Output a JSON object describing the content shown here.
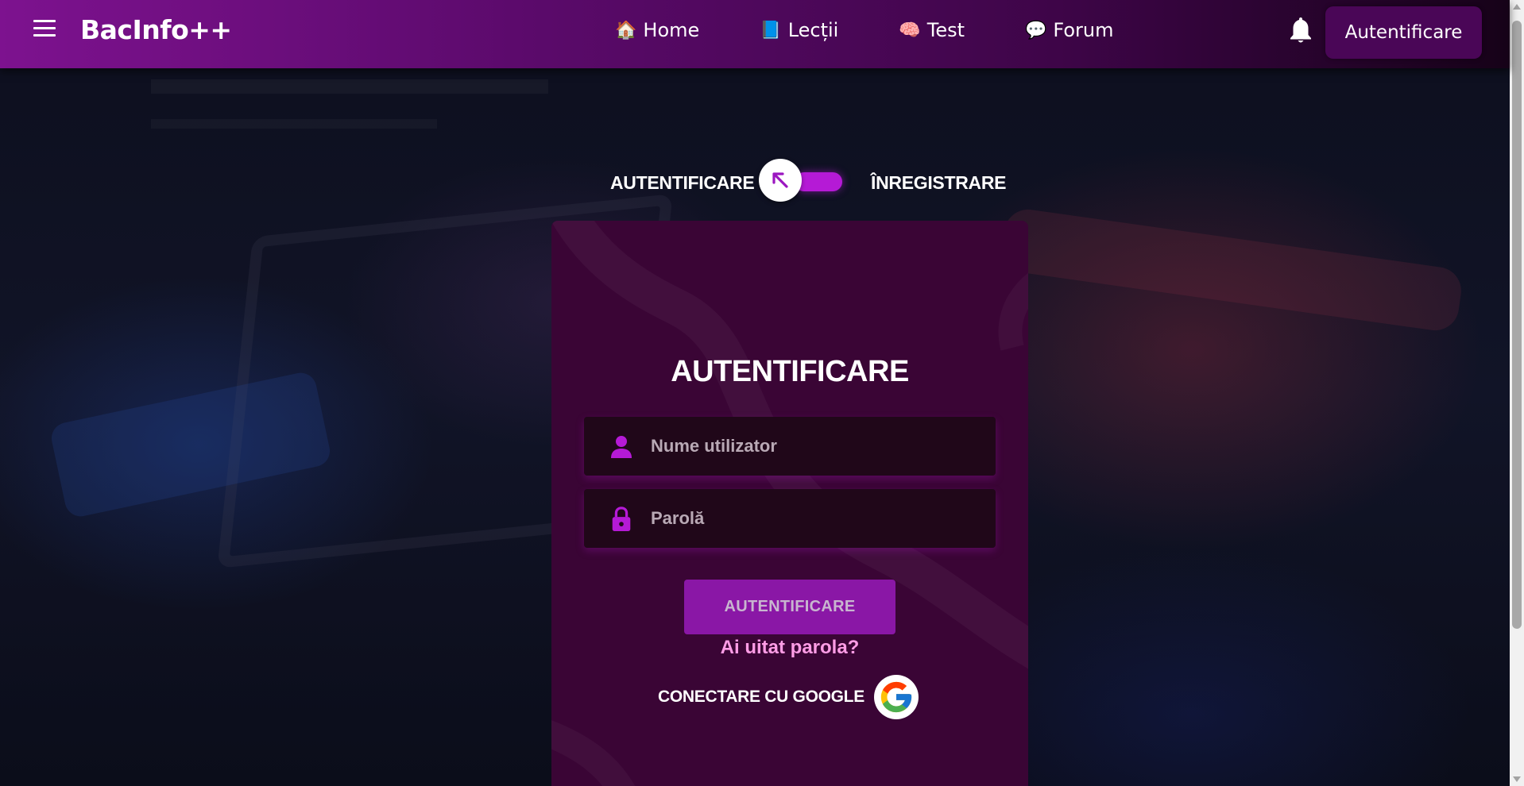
{
  "navbar": {
    "brand": "BacInfo++",
    "links": [
      {
        "emoji": "🏠",
        "label": "Home",
        "icon": "house-icon"
      },
      {
        "emoji": "📘",
        "label": "Lecții",
        "icon": "book-icon"
      },
      {
        "emoji": "🧠",
        "label": "Test",
        "icon": "brain-icon"
      },
      {
        "emoji": "💬",
        "label": "Forum",
        "icon": "speech-bubble-icon"
      }
    ],
    "notifications_icon": "bell-icon",
    "login_button": "Autentificare"
  },
  "mode_switch": {
    "left_label": "AUTENTIFICARE",
    "right_label": "ÎNREGISTRARE",
    "knob_icon": "arrow-up-left-icon",
    "accent_color": "#b51ad6"
  },
  "login_card": {
    "title": "AUTENTIFICARE",
    "username": {
      "placeholder": "Nume utilizator",
      "value": "",
      "icon": "user-icon"
    },
    "password": {
      "placeholder": "Parolă",
      "value": "",
      "icon": "lock-icon"
    },
    "submit_label": "AUTENTIFICARE",
    "forgot_link": "Ai uitat parola?",
    "google_label": "CONECTARE CU GOOGLE",
    "google_icon": "google-logo-icon",
    "background_color": "#3a0535",
    "icon_color": "#b51ad6"
  }
}
